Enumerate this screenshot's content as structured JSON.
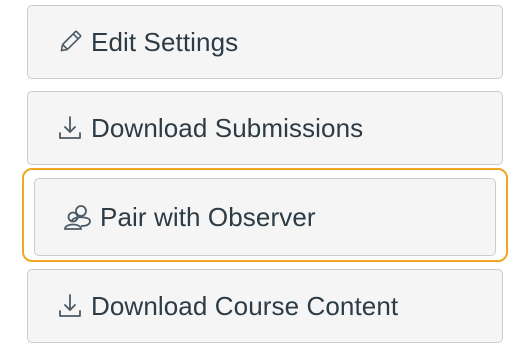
{
  "buttons": {
    "edit_settings": {
      "label": "Edit Settings",
      "icon": "pencil-icon"
    },
    "download_submissions": {
      "label": "Download Submissions",
      "icon": "download-icon"
    },
    "pair_with_observer": {
      "label": "Pair with Observer",
      "icon": "user-group-icon",
      "focused": true
    },
    "download_course_content": {
      "label": "Download Course Content",
      "icon": "download-icon"
    }
  },
  "colors": {
    "button_bg": "#f5f5f5",
    "button_border": "#c7cdd1",
    "text": "#2d3b45",
    "focus_ring": "#f0a623"
  }
}
